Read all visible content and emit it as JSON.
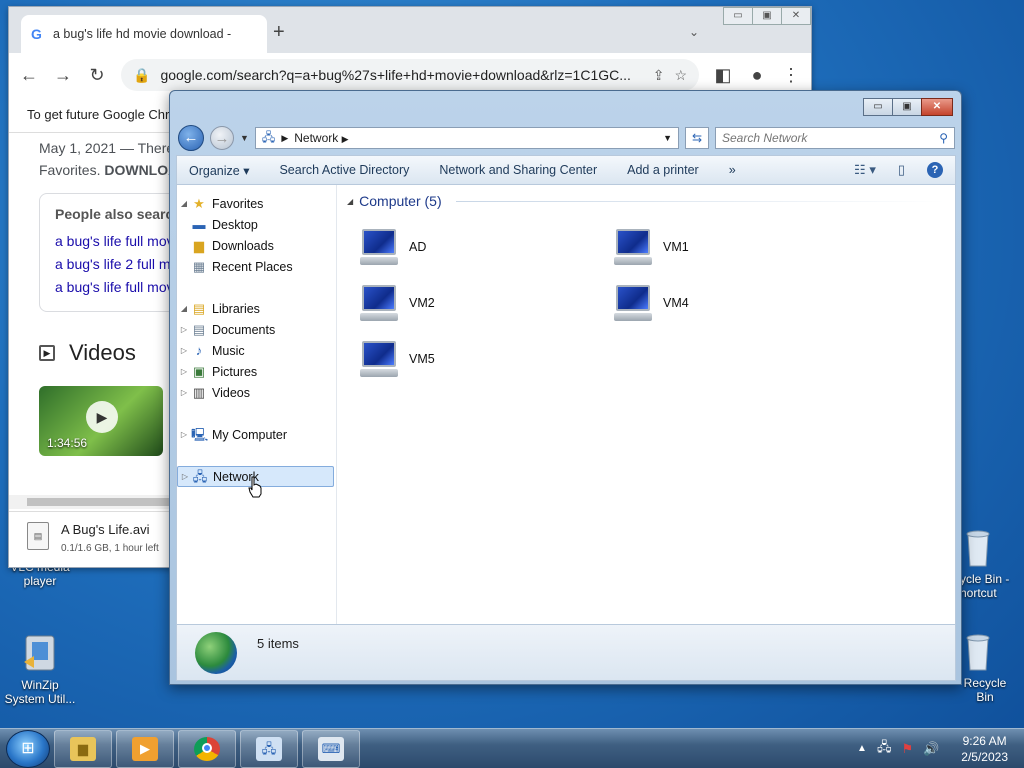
{
  "desktop": {
    "icons": [
      {
        "label": "VLC media\nplayer"
      },
      {
        "label": "WinZip\nSystem Util..."
      },
      {
        "label": "ycle Bin -\nhortcut"
      },
      {
        "label": "Recycle Bin"
      }
    ]
  },
  "chrome": {
    "tab_title": "a bug's life hd movie download -",
    "url": "google.com/search?q=a+bug%27s+life+hd+movie+download&rlz=1C1GC...",
    "info_bar": "To get future Google Chr",
    "snippet_line1": "May 1, 2021 — There",
    "snippet_line2_prefix": "Favorites. ",
    "snippet_line2_bold": "DOWNLOA",
    "paa_title": "People also search",
    "paa_links": [
      "a bug's life full mov",
      "a bug's life 2 full m",
      "a bug's life full mov"
    ],
    "videos_heading": "Videos",
    "video_duration": "1:34:56",
    "download_name": "A Bug's Life.avi",
    "download_status": "0.1/1.6 GB, 1 hour left"
  },
  "explorer": {
    "address_crumb": "Network",
    "search_placeholder": "Search Network",
    "commands": [
      "Organize ▾",
      "Search Active Directory",
      "Network and Sharing Center",
      "Add a printer",
      "»"
    ],
    "nav": {
      "favorites": "Favorites",
      "desktop": "Desktop",
      "downloads": "Downloads",
      "recent_places": "Recent Places",
      "libraries": "Libraries",
      "documents": "Documents",
      "music": "Music",
      "pictures": "Pictures",
      "videos": "Videos",
      "my_computer": "My Computer",
      "network": "Network"
    },
    "group_heading": "Computer (5)",
    "computers": [
      "AD",
      "VM1",
      "VM2",
      "VM4",
      "VM5"
    ],
    "status_count": "5 items"
  },
  "taskbar": {
    "time": "9:26 AM",
    "date": "2/5/2023"
  }
}
